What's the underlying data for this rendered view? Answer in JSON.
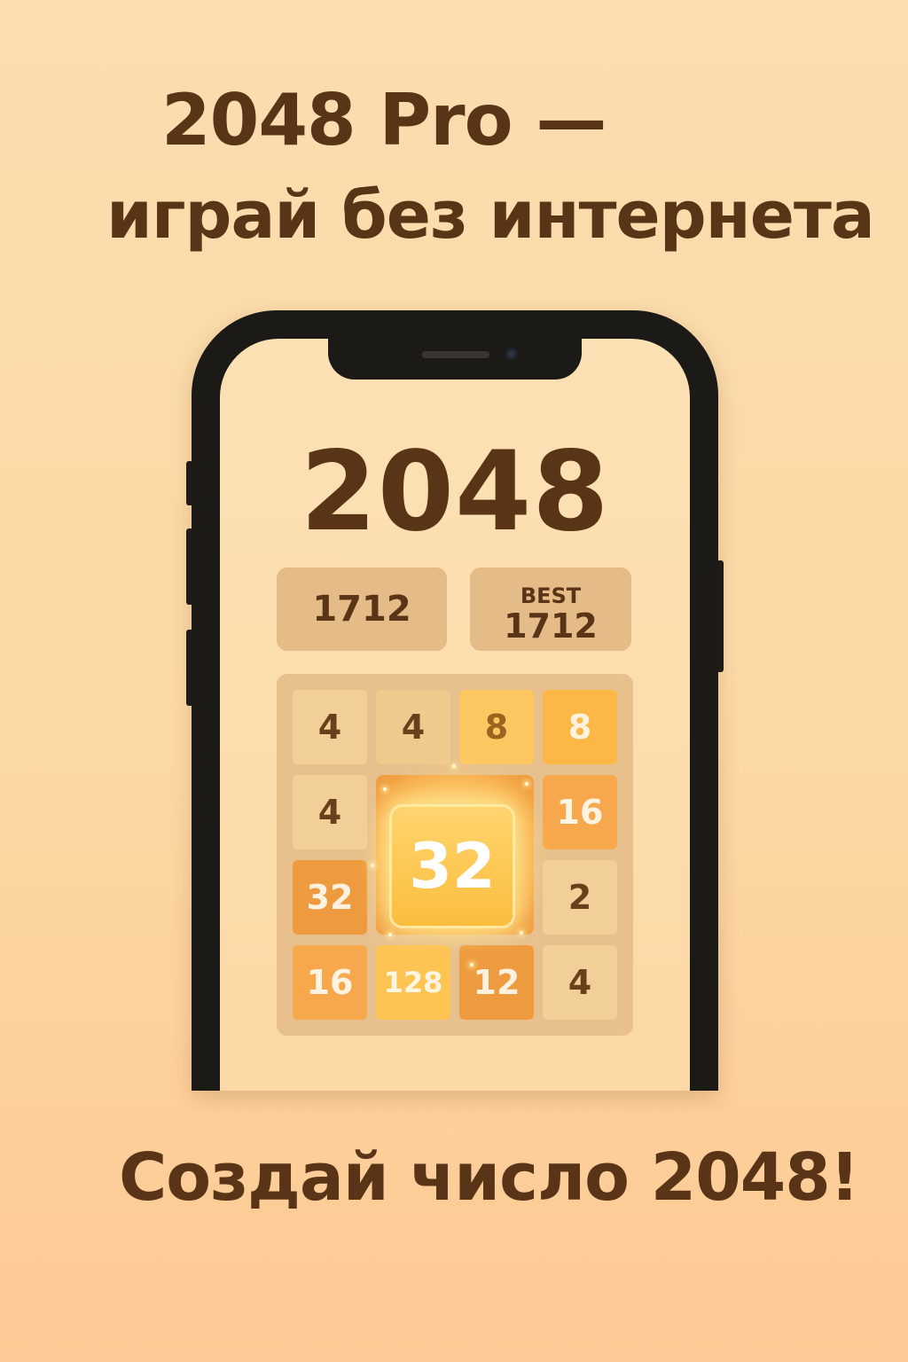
{
  "promo": {
    "headline_line1": "2048 Pro —",
    "headline_line2": "играй без интернета",
    "footer": "Создай число 2048!"
  },
  "game": {
    "title": "2048",
    "score": "1712",
    "best_label": "BEST",
    "best_score": "1712",
    "highlight_tile": "32",
    "tiles": [
      [
        "4",
        "4",
        "8",
        "8"
      ],
      [
        "4",
        "",
        "",
        "16"
      ],
      [
        "32",
        "",
        "",
        "2"
      ],
      [
        "16",
        "128",
        "12",
        "4"
      ]
    ]
  }
}
